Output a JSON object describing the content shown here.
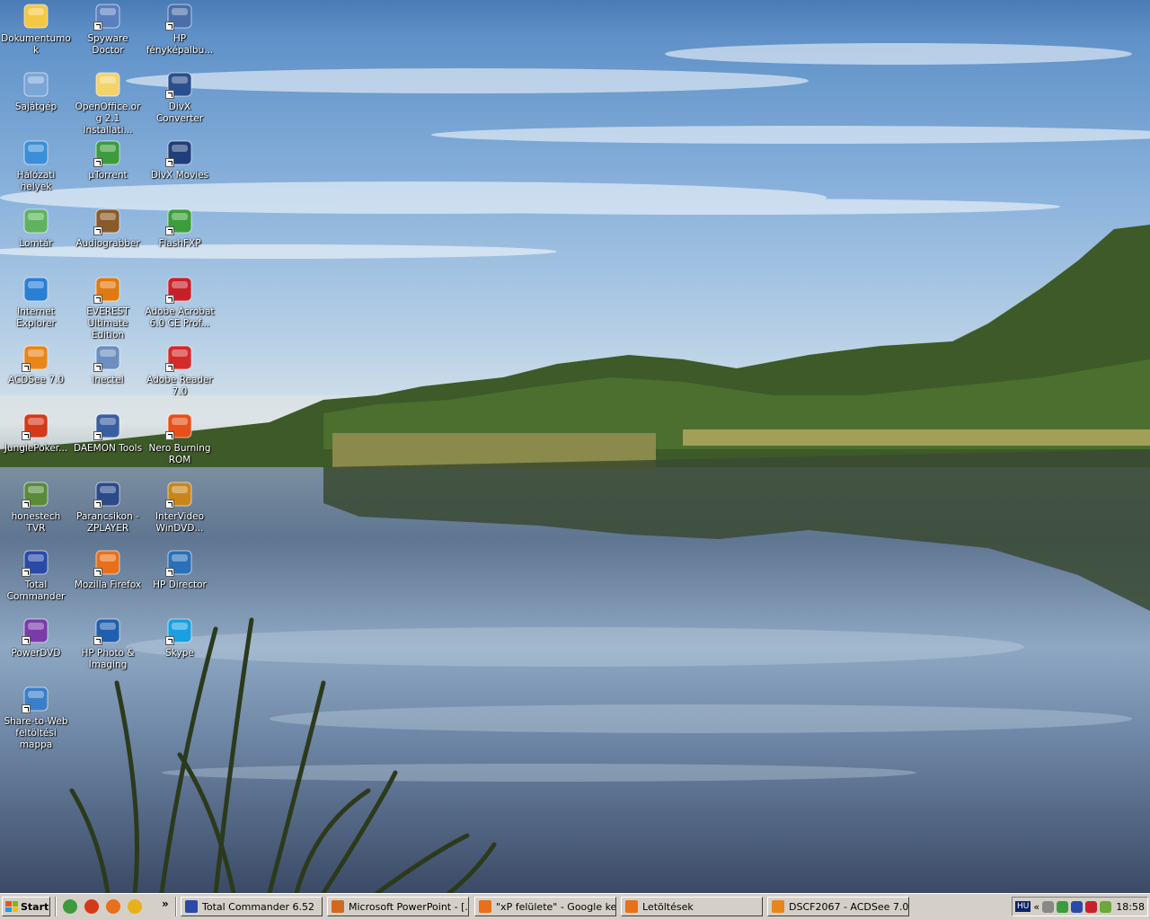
{
  "desktop": {
    "icons": [
      {
        "label": "Dokumentumok",
        "icon": "my-documents-folder-icon",
        "color": "#f5c842",
        "shortcut": false
      },
      {
        "label": "Spyware Doctor",
        "icon": "spyware-doctor-icon",
        "color": "#5a7fbf",
        "shortcut": true
      },
      {
        "label": "HP fényképalbu...",
        "icon": "hp-photo-album-icon",
        "color": "#4a6fa8",
        "shortcut": true
      },
      {
        "label": "Sajátgép",
        "icon": "my-computer-icon",
        "color": "#7aa6d6",
        "shortcut": false
      },
      {
        "label": "OpenOffice.org 2.1 Installati...",
        "icon": "folder-icon",
        "color": "#f3d36b",
        "shortcut": false
      },
      {
        "label": "DivX Converter",
        "icon": "divx-converter-icon",
        "color": "#2a4f8f",
        "shortcut": true
      },
      {
        "label": "Hálózati helyek",
        "icon": "network-places-icon",
        "color": "#3a8fd8",
        "shortcut": false
      },
      {
        "label": "µTorrent",
        "icon": "utorrent-icon",
        "color": "#3c9b3c",
        "shortcut": true
      },
      {
        "label": "DivX Movies",
        "icon": "divx-movies-icon",
        "color": "#1f3f7a",
        "shortcut": true
      },
      {
        "label": "Lomtár",
        "icon": "recycle-bin-icon",
        "color": "#5fb35f",
        "shortcut": false
      },
      {
        "label": "Audiograbber",
        "icon": "audiograbber-icon",
        "color": "#8a5a2a",
        "shortcut": true
      },
      {
        "label": "FlashFXP",
        "icon": "flashfxp-icon",
        "color": "#3a9f3a",
        "shortcut": true
      },
      {
        "label": "Internet Explorer",
        "icon": "internet-explorer-icon",
        "color": "#2a7fd4",
        "shortcut": false
      },
      {
        "label": "EVEREST Ultimate Edition",
        "icon": "everest-icon",
        "color": "#e07a10",
        "shortcut": true
      },
      {
        "label": "Adobe Acrobat 6.0 CE Prof...",
        "icon": "adobe-acrobat-icon",
        "color": "#c8202a",
        "shortcut": true
      },
      {
        "label": "ACDSee 7.0",
        "icon": "acdsee-icon",
        "color": "#e8861a",
        "shortcut": true
      },
      {
        "label": "Inectel",
        "icon": "inectel-network-icon",
        "color": "#6a8fc0",
        "shortcut": true
      },
      {
        "label": "Adobe Reader 7.0",
        "icon": "adobe-reader-icon",
        "color": "#d42a2a",
        "shortcut": true
      },
      {
        "label": "JunglePoker...",
        "icon": "junglepoker-icon",
        "color": "#d43a1a",
        "shortcut": true
      },
      {
        "label": "DAEMON Tools",
        "icon": "daemon-tools-icon",
        "color": "#3a5fa0",
        "shortcut": true
      },
      {
        "label": "Nero Burning ROM",
        "icon": "nero-icon",
        "color": "#e8501a",
        "shortcut": true
      },
      {
        "label": "honestech TVR",
        "icon": "honestech-tvr-icon",
        "color": "#5a8a3a",
        "shortcut": true
      },
      {
        "label": "Parancsikon - ZPLAYER",
        "icon": "zplayer-icon",
        "color": "#2a4a8a",
        "shortcut": true
      },
      {
        "label": "InterVideo WinDVD...",
        "icon": "windvd-icon",
        "color": "#c8861a",
        "shortcut": true
      },
      {
        "label": "Total Commander",
        "icon": "total-commander-icon",
        "color": "#2a4aa8",
        "shortcut": true
      },
      {
        "label": "Mozilla Firefox",
        "icon": "firefox-icon",
        "color": "#e8701a",
        "shortcut": true
      },
      {
        "label": "HP Director",
        "icon": "hp-director-icon",
        "color": "#2a6fb8",
        "shortcut": true
      },
      {
        "label": "PowerDVD",
        "icon": "powerdvd-icon",
        "color": "#7a3aa8",
        "shortcut": true
      },
      {
        "label": "HP Photo & Imaging",
        "icon": "hp-photo-imaging-icon",
        "color": "#1f5fb0",
        "shortcut": true
      },
      {
        "label": "Skype",
        "icon": "skype-icon",
        "color": "#1a9fe0",
        "shortcut": true
      },
      {
        "label": "Share-to-Web feltöltési mappa",
        "icon": "share-to-web-icon",
        "color": "#3a7fc8",
        "shortcut": true
      }
    ]
  },
  "taskbar": {
    "start_label": "Start",
    "quick_launch": [
      {
        "icon": "utorrent-ql-icon",
        "color": "#3c9b3c"
      },
      {
        "icon": "ql-app-icon",
        "color": "#d43a1a"
      },
      {
        "icon": "firefox-ql-icon",
        "color": "#e8701a"
      },
      {
        "icon": "ql-tool-icon",
        "color": "#e8b01a"
      }
    ],
    "chevron": "»",
    "tasks": [
      {
        "label": "Total Commander 6.52",
        "icon": "total-commander-task-icon",
        "color": "#2a4aa8"
      },
      {
        "label": "Microsoft PowerPoint - [...",
        "icon": "powerpoint-task-icon",
        "color": "#d2691e"
      },
      {
        "label": "\"xP felülete\" - Google ker...",
        "icon": "firefox-task-icon",
        "color": "#e8701a"
      },
      {
        "label": "Letöltések",
        "icon": "downloads-task-icon",
        "color": "#e8701a"
      },
      {
        "label": "DSCF2067 - ACDSee 7.0",
        "icon": "acdsee-task-icon",
        "color": "#e8861a"
      }
    ],
    "tray": {
      "language": "HU",
      "collapse": "«",
      "clock": "18:58"
    }
  }
}
